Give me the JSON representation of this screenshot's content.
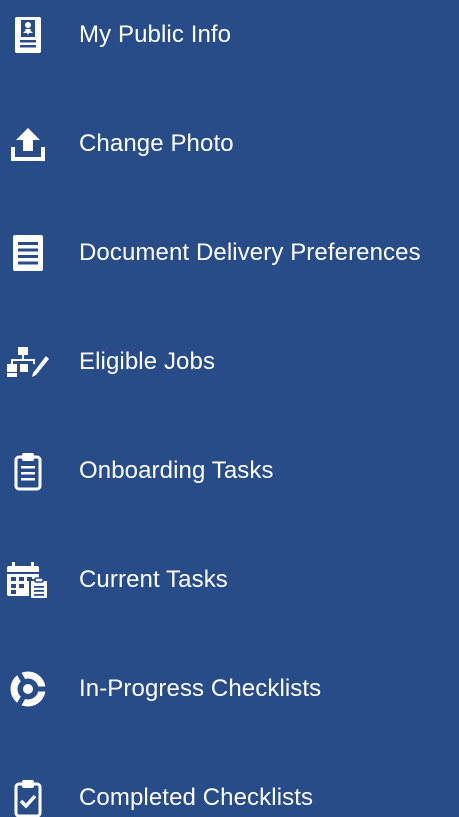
{
  "theme": {
    "background": "#284c88",
    "text": "#ffffff",
    "icon": "#ffffff"
  },
  "menu": {
    "items": [
      {
        "label": "My Public Info",
        "icon": "id-card-icon"
      },
      {
        "label": "Change Photo",
        "icon": "upload-icon"
      },
      {
        "label": "Document Delivery Preferences",
        "icon": "document-icon"
      },
      {
        "label": "Eligible Jobs",
        "icon": "org-chart-edit-icon"
      },
      {
        "label": "Onboarding Tasks",
        "icon": "clipboard-list-icon"
      },
      {
        "label": "Current Tasks",
        "icon": "calendar-tasks-icon"
      },
      {
        "label": "In-Progress Checklists",
        "icon": "progress-cycle-icon"
      },
      {
        "label": "Completed Checklists",
        "icon": "clipboard-check-icon"
      }
    ]
  }
}
